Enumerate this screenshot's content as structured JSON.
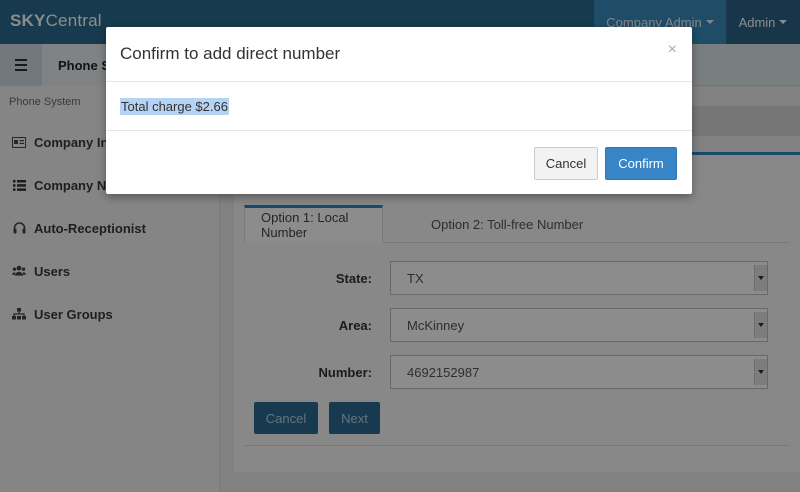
{
  "topbar": {
    "brand_bold": "SKY",
    "brand_rest": "Central",
    "company_menu": "Company Admin",
    "admin_menu": "Admin"
  },
  "subbar": {
    "tab_label": "Phone System"
  },
  "sidebar": {
    "section": "Phone System",
    "items": [
      {
        "label": "Company Info",
        "icon": "id-card-icon"
      },
      {
        "label": "Company Numbers",
        "icon": "list-icon"
      },
      {
        "label": "Auto-Receptionist",
        "icon": "headset-icon"
      },
      {
        "label": "Users",
        "icon": "users-icon"
      },
      {
        "label": "User Groups",
        "icon": "sitemap-icon"
      }
    ]
  },
  "main": {
    "tabs": [
      {
        "label": "Option 1: Local Number",
        "active": true
      },
      {
        "label": "Option 2: Toll-free Number",
        "active": false
      }
    ],
    "fields": [
      {
        "label": "State:",
        "value": "TX"
      },
      {
        "label": "Area:",
        "value": "McKinney"
      },
      {
        "label": "Number:",
        "value": "4692152987"
      }
    ],
    "cancel_label": "Cancel",
    "next_label": "Next"
  },
  "modal": {
    "title": "Confirm to add direct number",
    "close": "×",
    "body": "Total charge $2.66",
    "cancel_label": "Cancel",
    "confirm_label": "Confirm"
  },
  "colors": {
    "topbar": "#2d6a8f",
    "accent": "#2f86c4",
    "primary_button": "#3784c6",
    "selection_highlight": "#b5d3f2"
  }
}
